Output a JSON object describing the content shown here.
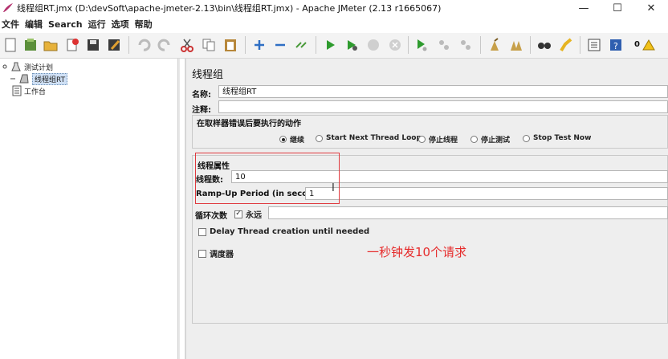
{
  "window": {
    "title": "线程组RT.jmx (D:\\devSoft\\apache-jmeter-2.13\\bin\\线程组RT.jmx) - Apache JMeter (2.13 r1665067)",
    "minimize": "—",
    "maximize": "☐",
    "close": "✕"
  },
  "menu": [
    "文件",
    "编辑",
    "Search",
    "运行",
    "选项",
    "帮助"
  ],
  "toolbar": {
    "error_count": "0",
    "icons": [
      "new-icon",
      "templates-icon",
      "open-icon",
      "close-icon",
      "save-icon",
      "save-as-icon",
      "undo-icon",
      "redo-icon",
      "cut-icon",
      "copy-icon",
      "paste-icon",
      "expand-icon",
      "collapse-icon",
      "toggle-icon",
      "start-icon",
      "start-no-pause-icon",
      "stop-icon",
      "shutdown-icon",
      "remote-start-icon",
      "remote-stop-icon",
      "remote-shutdown-icon",
      "clear-icon",
      "clear-all-icon",
      "search-icon",
      "reset-search-icon",
      "function-helper-icon",
      "help-icon",
      "warning-icon"
    ]
  },
  "tree": {
    "root": "测试计划",
    "thread_group": "线程组RT",
    "workbench": "工作台"
  },
  "panel": {
    "title": "线程组",
    "name_label": "名称:",
    "name_value": "线程组RT",
    "comment_label": "注释:",
    "comment_value": "",
    "error_action": {
      "legend": "在取样器错误后要执行的动作",
      "options": [
        "继续",
        "Start Next Thread Loop",
        "停止线程",
        "停止测试",
        "Stop Test Now"
      ],
      "selected": 0
    },
    "thread_props": {
      "legend": "线程属性",
      "threads_label": "线程数:",
      "threads_value": "10",
      "rampup_label": "Ramp-Up Period (in seconds):",
      "rampup_value": "1",
      "loop_label": "循环次数",
      "forever_label": "永远",
      "forever_checked": true,
      "loop_value": ""
    },
    "delay_label": "Delay Thread creation until needed",
    "delay_checked": false,
    "scheduler_label": "调度器",
    "scheduler_checked": false
  },
  "annotation": "一秒钟发10个请求",
  "colors": {
    "annotation": "#e62b2b",
    "highlight_box": "#e0393e"
  }
}
